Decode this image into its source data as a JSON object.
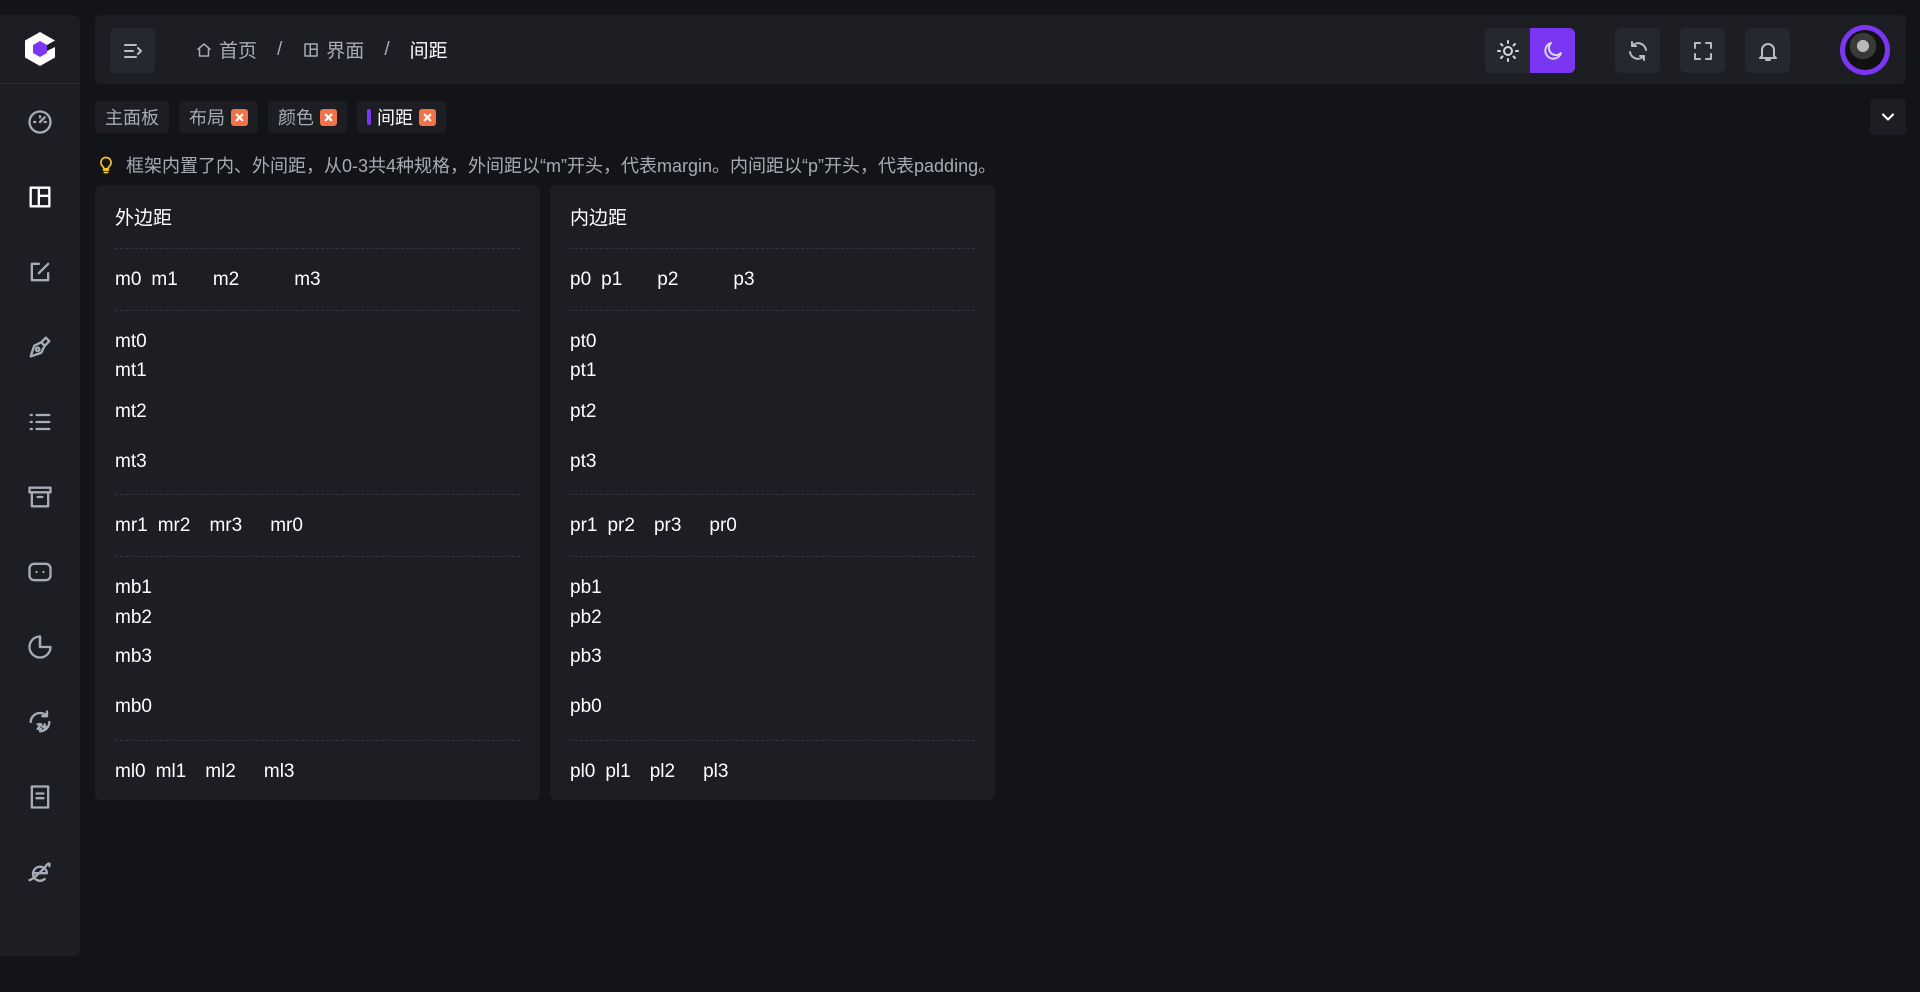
{
  "breadcrumb": {
    "home": "首页",
    "section": "界面",
    "current": "间距"
  },
  "tabs": [
    {
      "label": "主面板",
      "closable": false
    },
    {
      "label": "布局",
      "closable": true
    },
    {
      "label": "颜色",
      "closable": true
    },
    {
      "label": "间距",
      "closable": true,
      "active": true
    }
  ],
  "tip": "框架内置了内、外间距，从0-3共4种规格，外间距以“m”开头，代表margin。内间距以“p”开头，代表padding。",
  "margin_card": {
    "title": "外边距",
    "m": [
      "m0",
      "m1",
      "m2",
      "m3"
    ],
    "mt": [
      "mt0",
      "mt1",
      "mt2",
      "mt3"
    ],
    "mr": [
      "mr1",
      "mr2",
      "mr3",
      "mr0"
    ],
    "mb": [
      "mb1",
      "mb2",
      "mb3",
      "mb0"
    ],
    "ml": [
      "ml0",
      "ml1",
      "ml2",
      "ml3"
    ]
  },
  "padding_card": {
    "title": "内边距",
    "p": [
      "p0",
      "p1",
      "p2",
      "p3"
    ],
    "pt": [
      "pt0",
      "pt1",
      "pt2",
      "pt3"
    ],
    "pr": [
      "pr1",
      "pr2",
      "pr3",
      "pr0"
    ],
    "pb": [
      "pb1",
      "pb2",
      "pb3",
      "pb0"
    ],
    "pl": [
      "pl0",
      "pl1",
      "pl2",
      "pl3"
    ]
  },
  "sidebar_icons": [
    "dashboard-icon",
    "layout-icon",
    "edit-icon",
    "pen-icon",
    "list-icon",
    "archive-icon",
    "chat-icon",
    "chart-pie-icon",
    "clock-24-icon",
    "document-icon",
    "browser-icon"
  ],
  "colors": {
    "accent": "#7a36f2",
    "close": "#f27349",
    "tip": "#f7c52d"
  }
}
